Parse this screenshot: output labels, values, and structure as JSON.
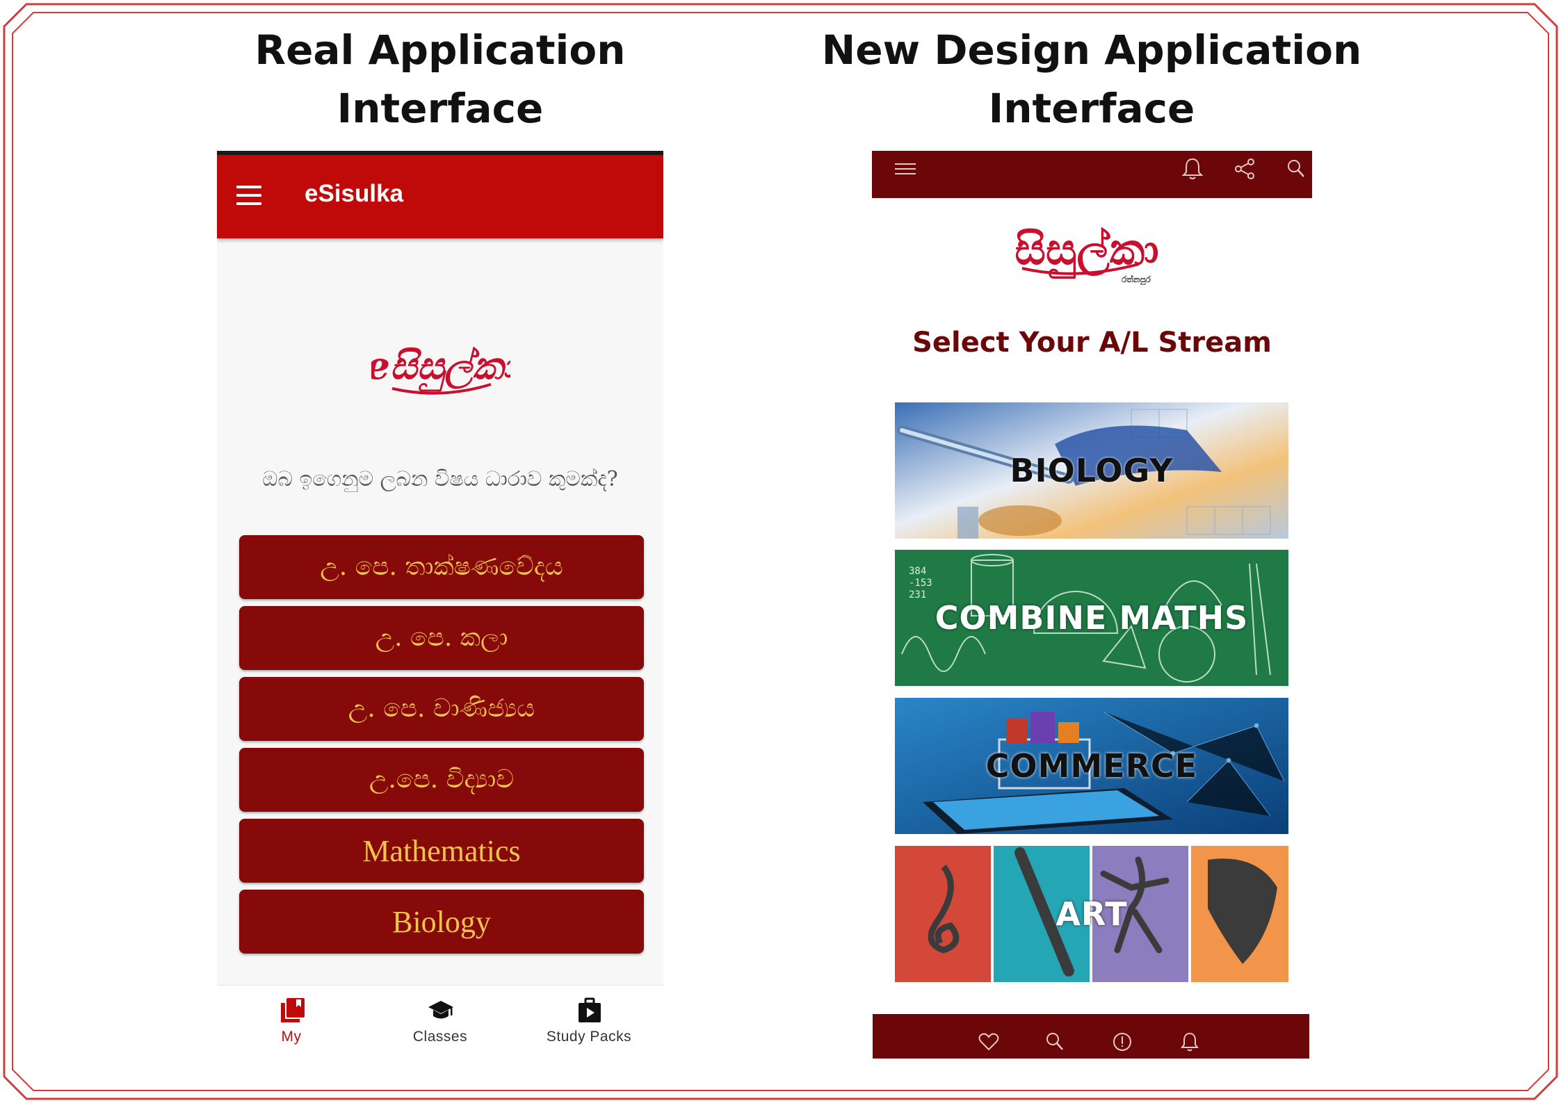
{
  "headings": {
    "left_line1": "Real Application",
    "left_line2": "Interface",
    "right_line1": "New Design Application",
    "right_line2": "Interface"
  },
  "left_app": {
    "title": "eSisulka",
    "logo_text": "eසිසුල්කා",
    "question": "ඔබ ඉගෙනුම ලබන විෂය ධාරාව කුමක්ද?",
    "streams": [
      "උ. පෙ. තාක්ෂණවේදය",
      "උ. පෙ. කලා",
      "උ. පෙ. වාණිජ්‍යය",
      "උ.පෙ. විද්‍යාව",
      "Mathematics",
      "Biology"
    ],
    "bottom_nav": [
      {
        "label": "My",
        "icon": "bookmark-library-icon",
        "active": true
      },
      {
        "label": "Classes",
        "icon": "graduation-cap-icon",
        "active": false
      },
      {
        "label": "Study Packs",
        "icon": "video-briefcase-icon",
        "active": false
      }
    ]
  },
  "right_app": {
    "logo_text": "සිසුල්කා",
    "logo_sub": "රත්නපුර",
    "toolbar_icons": [
      "menu-icon",
      "bell-icon",
      "share-icon",
      "search-icon"
    ],
    "select_title": "Select Your A/L Stream",
    "cards": [
      {
        "label": "BIOLOGY",
        "image": "lab-pipette-image"
      },
      {
        "label": "COMBINE MATHS",
        "image": "chalkboard-math-image"
      },
      {
        "label": "COMMERCE",
        "image": "ecommerce-cart-image"
      },
      {
        "label": "ART",
        "image": "music-paint-dance-theatre-image"
      }
    ],
    "bottom_icons": [
      "heart-icon",
      "search-icon",
      "info-icon",
      "bell-icon"
    ]
  },
  "colors": {
    "frame_border": "#d23c3c",
    "left_appbar": "#c00a0a",
    "stream_button": "#870a0a",
    "stream_text": "#f2c44a",
    "right_bar": "#6b0609",
    "right_title": "#6b0609"
  }
}
